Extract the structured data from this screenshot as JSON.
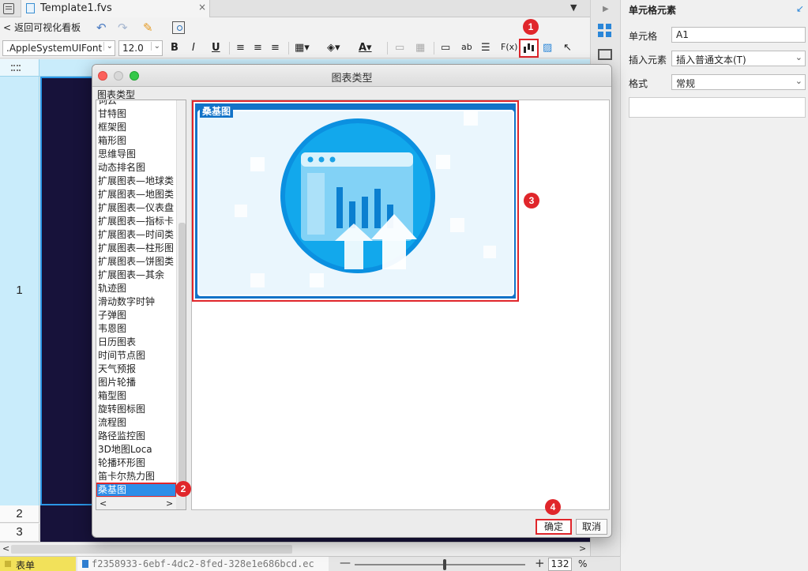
{
  "tabbar": {
    "file_tab": "Template1.fvs",
    "close_glyph": "×",
    "menu_glyph": "▼"
  },
  "toolbar1": {
    "back_label": "返回可视化看板",
    "icons": [
      "undo-icon",
      "redo-icon",
      "format-painter-icon",
      "preview-icon"
    ]
  },
  "toolbar2": {
    "font": ".AppleSystemUIFont",
    "font_size": "12.0",
    "bold": "B",
    "italic": "I",
    "underline": "U",
    "text_label": "ab",
    "formula_label": "F(x)"
  },
  "grid": {
    "rows": [
      "1",
      "2",
      "3"
    ]
  },
  "statusbar": {
    "sheet_tab": "表单",
    "data_tab": "f2358933-6ebf-4dc2-8fed-328e1e686bcd.ec",
    "zoom_minus": "—",
    "zoom_plus": "+",
    "zoom": "132",
    "zoom_unit": "%",
    "zoom_fraction": 0.52
  },
  "panel": {
    "title": "单元格元素",
    "cell_label": "单元格",
    "cell_value": "A1",
    "insert_label": "插入元素",
    "insert_value": "插入普通文本(T)",
    "format_label": "格式",
    "format_value": "常规"
  },
  "dialog": {
    "title": "图表类型",
    "group_label": "图表类型",
    "chart_types": [
      "词云",
      "甘特图",
      "框架图",
      "箱形图",
      "思维导图",
      "动态排名图",
      "扩展图表—地球类",
      "扩展图表—地图类",
      "扩展图表—仪表盘",
      "扩展图表—指标卡",
      "扩展图表—时间类",
      "扩展图表—柱形图",
      "扩展图表—饼图类",
      "扩展图表—其余",
      "轨迹图",
      "滑动数字时钟",
      "子弹图",
      "韦恩图",
      "日历图表",
      "时间节点图",
      "天气预报",
      "图片轮播",
      "箱型图",
      "旋转图标图",
      "流程图",
      "路径监控图",
      "3D地图Loca",
      "轮播环形图",
      "笛卡尔热力图",
      "桑基图"
    ],
    "selected": "桑基图",
    "preview_title": "桑基图",
    "confirm": "确定",
    "cancel": "取消"
  },
  "badges": [
    "1",
    "2",
    "3",
    "4"
  ],
  "colors": {
    "accent": "#e0262b",
    "selection": "#2d8ee8",
    "cell_fill": "#17123a",
    "card_blue": "#1273c8"
  }
}
